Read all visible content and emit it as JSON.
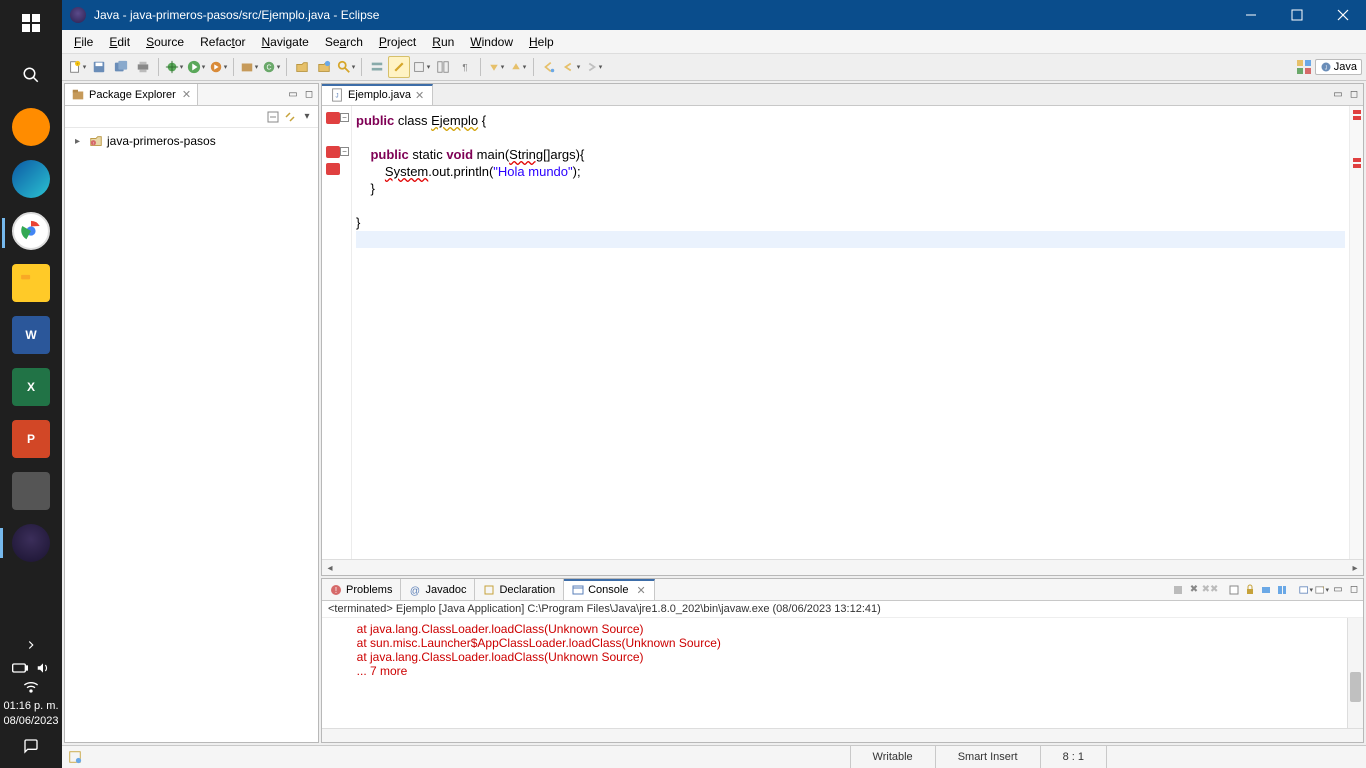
{
  "taskbar": {
    "clock_time": "01:16 p. m.",
    "clock_date": "08/06/2023"
  },
  "window": {
    "title": "Java - java-primeros-pasos/src/Ejemplo.java - Eclipse"
  },
  "menu": [
    "File",
    "Edit",
    "Source",
    "Refactor",
    "Navigate",
    "Search",
    "Project",
    "Run",
    "Window",
    "Help"
  ],
  "perspective": {
    "label": "Java"
  },
  "package_explorer": {
    "title": "Package Explorer",
    "project": "java-primeros-pasos"
  },
  "editor": {
    "tab_label": "Ejemplo.java",
    "code": {
      "l1a": "public",
      "l1b": " class ",
      "l1c": "Ejemplo",
      "l1d": " {",
      "l2_indent": "    ",
      "l3a": "public",
      "l3b": " static ",
      "l3c": "void",
      "l3d": " main(",
      "l3e": "String",
      "l3f": "[]args){",
      "l4_indent": "        ",
      "l4a": "System",
      "l4b": ".out.println(",
      "l4c": "\"Hola mundo\"",
      "l4d": ");",
      "l5_indent": "    ",
      "l5": "}",
      "l7": "}"
    }
  },
  "bottom_tabs": {
    "problems": "Problems",
    "javadoc": "Javadoc",
    "declaration": "Declaration",
    "console": "Console"
  },
  "console": {
    "header": "<terminated> Ejemplo [Java Application] C:\\Program Files\\Java\\jre1.8.0_202\\bin\\javaw.exe (08/06/2023 13:12:41)",
    "lines": [
      "        at java.lang.ClassLoader.loadClass(Unknown Source)",
      "        at sun.misc.Launcher$AppClassLoader.loadClass(Unknown Source)",
      "        at java.lang.ClassLoader.loadClass(Unknown Source)",
      "        ... 7 more"
    ]
  },
  "status": {
    "writable": "Writable",
    "insert": "Smart Insert",
    "pos": "8 : 1"
  }
}
